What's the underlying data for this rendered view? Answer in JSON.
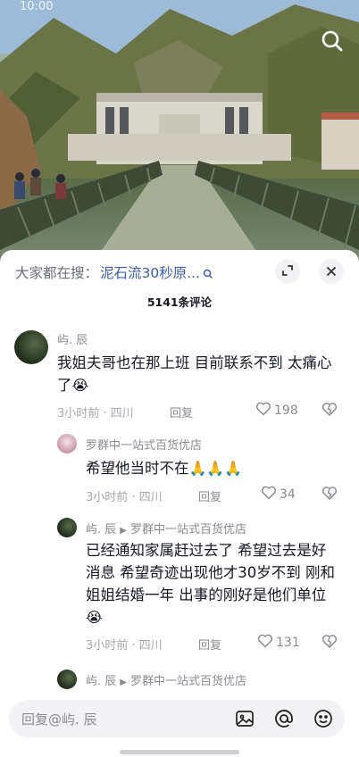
{
  "status_bar": {
    "time": "10:00"
  },
  "sheet": {
    "trend_prefix": "大家都在搜：",
    "trend_query": "泥石流30秒原...",
    "comment_count": "5141条评论"
  },
  "comments": [
    {
      "author": "屿. 辰",
      "text": "我姐夫哥也在那上班 目前联系不到 太痛心了",
      "emoji": "😭",
      "time": "3小时前 · 四川",
      "reply_label": "回复",
      "likes": "198"
    },
    {
      "author": "罗群中一站式百货优店",
      "text": "希望他当时不在",
      "emoji": "🙏🙏🙏",
      "time": "3小时前 · 四川",
      "reply_label": "回复",
      "likes": "34"
    },
    {
      "author": "屿. 辰",
      "reply_to": "罗群中一站式百货优店",
      "text": "已经通知家属赶过去了 希望过去是好消息 希望奇迹出现他才30岁不到 刚和姐姐结婚一年 出事的刚好是他们单位",
      "emoji": "😭",
      "time": "3小时前 · 四川",
      "reply_label": "回复",
      "likes": "131"
    },
    {
      "author": "屿. 辰",
      "reply_to": "罗群中一站式百货优店"
    }
  ],
  "input": {
    "placeholder": "回复@屿. 辰"
  },
  "colors": {
    "accent_link": "#3d5fa8",
    "muted": "#8a8b91"
  },
  "icons": [
    "search-icon",
    "expand-icon",
    "close-icon",
    "heart-icon",
    "dislike-icon",
    "image-icon",
    "at-icon",
    "emoji-icon"
  ]
}
